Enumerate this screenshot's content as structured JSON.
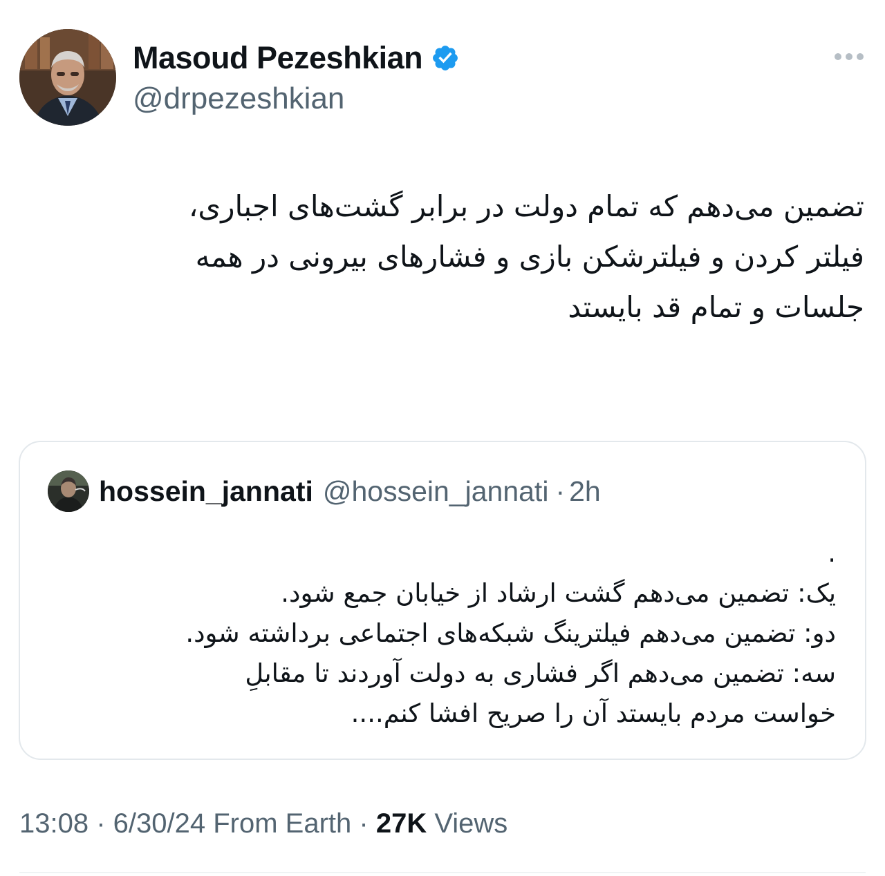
{
  "author": {
    "display_name": "Masoud Pezeshkian",
    "handle": "@drpezeshkian",
    "verified": true,
    "avatar_icon": "profile-photo"
  },
  "tweet": {
    "text": "تضمین می‌دهم که تمام دولت در برابر  گشت‌های اجباری،\nفیلتر کردن و فیلترشکن بازی و فشارهای بیرونی در همه\nجلسات و تمام قد بایستد"
  },
  "quote": {
    "display_name": "hossein_jannati",
    "handle": "@hossein_jannati",
    "separator": "·",
    "time": "2h",
    "text": ".\nیک: تضمین می‌دهم گشت ارشاد از خیابان جمع شود.\nدو: تضمین می‌دهم فیلترینگ شبکه‌های اجتماعی برداشته شود.\nسه: تضمین می‌دهم اگر فشاری به دولت آوردند تا مقابلِ\nخواست مردم بایستد آن را صریح افشا کنم...."
  },
  "meta": {
    "time": "13:08",
    "sep1": " · ",
    "date": "6/30/24",
    "source": " From Earth",
    "sep2": " · ",
    "views_count": "27K",
    "views_label": " Views"
  },
  "colors": {
    "accent_blue": "#1d9bf0",
    "text_primary": "#0f1419",
    "text_secondary": "#536471",
    "border": "#e3e8ec"
  }
}
